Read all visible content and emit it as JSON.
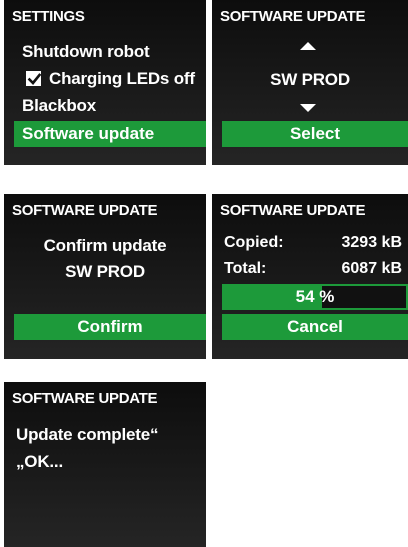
{
  "screens": {
    "settings": {
      "title": "SETTINGS",
      "items": [
        {
          "label": "Shutdown robot"
        },
        {
          "label": "Charging LEDs off",
          "checked": true
        },
        {
          "label": "Blackbox"
        },
        {
          "label": "Software update",
          "selected": true
        }
      ]
    },
    "update_select": {
      "title": "SOFTWARE UPDATE",
      "option": "SW PROD",
      "select_label": "Select",
      "up_icon": "triangle-up-icon",
      "down_icon": "triangle-down-icon"
    },
    "confirm": {
      "title": "SOFTWARE UPDATE",
      "line1": "Confirm update",
      "line2": "SW PROD",
      "confirm_label": "Confirm"
    },
    "progress": {
      "title": "SOFTWARE UPDATE",
      "copied_label": "Copied:",
      "copied_value": "3293 kB",
      "total_label": "Total:",
      "total_value": "6087 kB",
      "percent_number": "54",
      "percent_sign": "%",
      "percent_value": 54,
      "cancel_label": "Cancel"
    },
    "complete": {
      "title": "SOFTWARE UPDATE",
      "line1": "Update complete“",
      "line2": "„OK..."
    }
  },
  "colors": {
    "accent": "#1d9a3a",
    "screen_bg": "#111111",
    "text": "#ffffff"
  }
}
